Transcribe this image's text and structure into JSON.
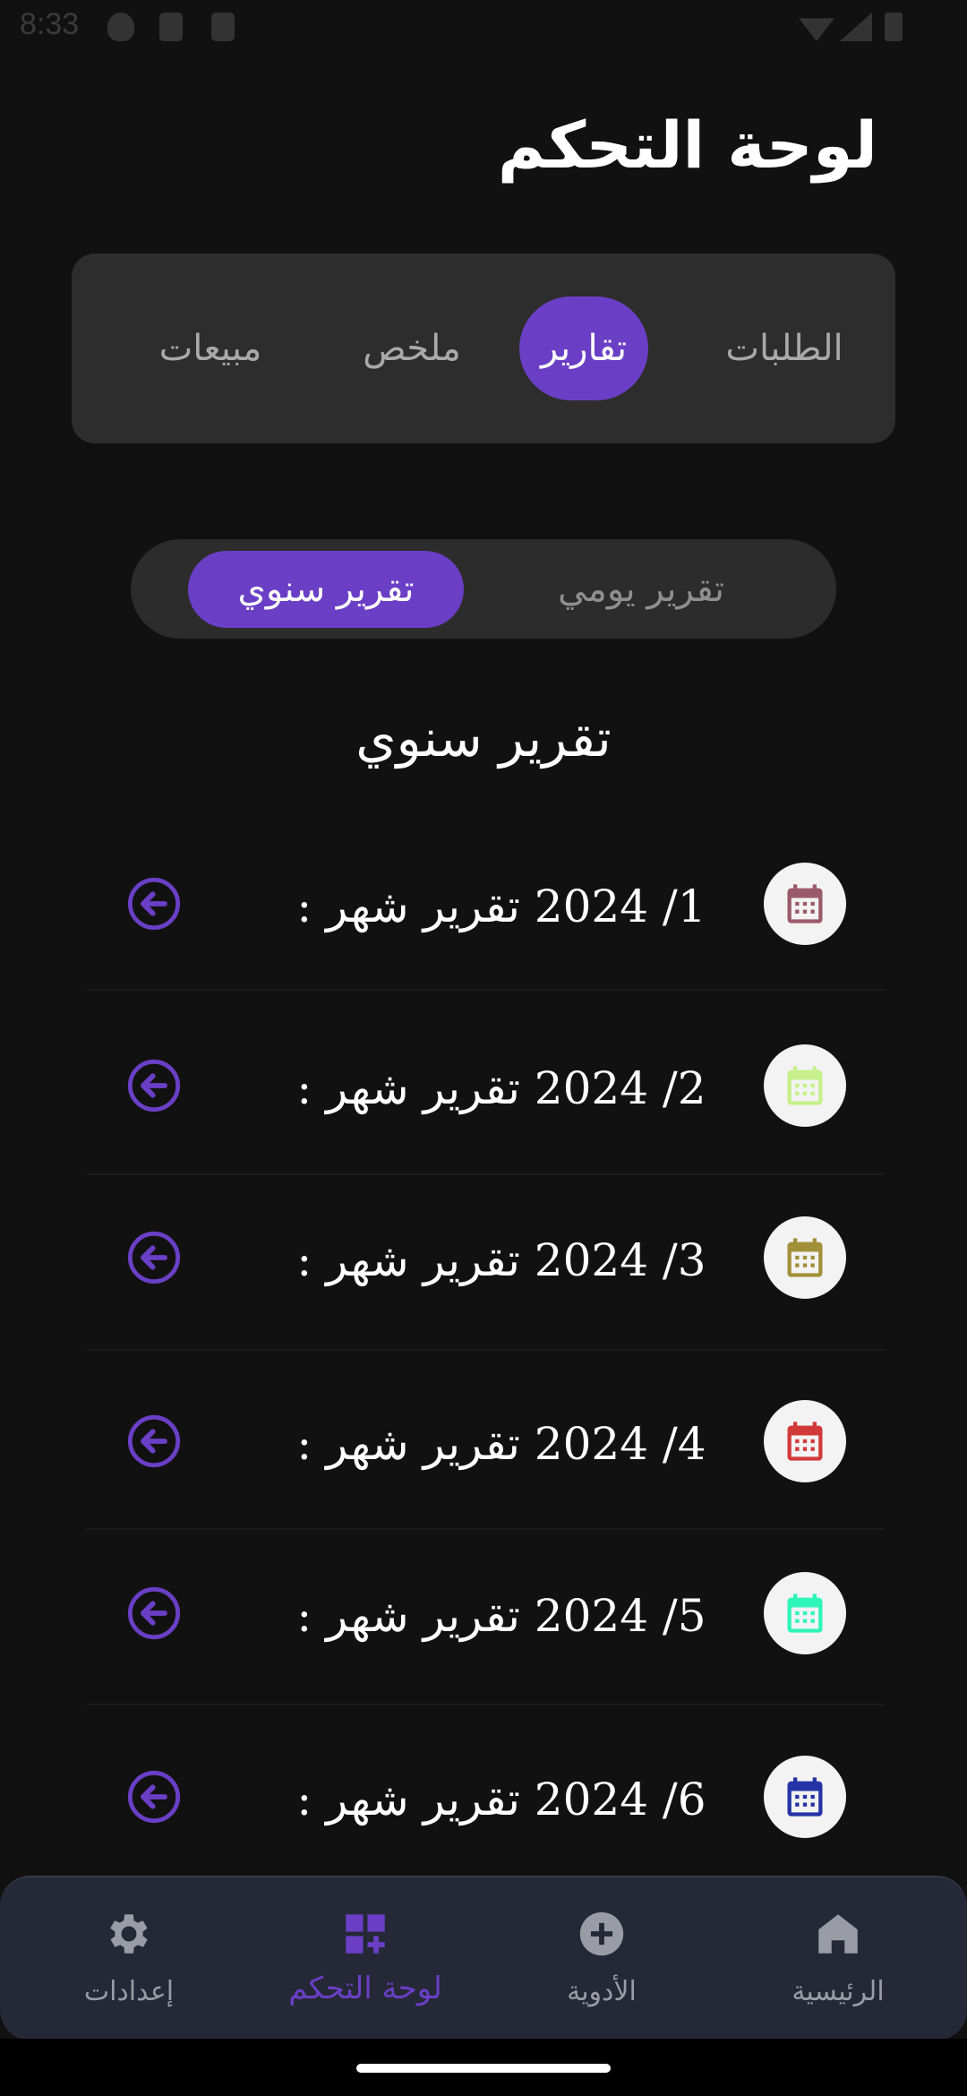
{
  "status_bar": {
    "time": "8:33"
  },
  "title": "لوحة التحكم",
  "main_tabs": [
    {
      "label": "الطلبات",
      "active": false
    },
    {
      "label": "تقارير",
      "active": true
    },
    {
      "label": "ملخص",
      "active": false
    },
    {
      "label": "مبيعات",
      "active": false
    }
  ],
  "segment": {
    "daily": "تقرير يومي",
    "yearly": "تقرير سنوي",
    "selected": "yearly"
  },
  "section_title": "تقرير سنوي",
  "reports": [
    {
      "label": "تقرير شهر  :",
      "value": "2024 /1",
      "icon": "calendar-icon",
      "color": "#9b5a6c"
    },
    {
      "label": "تقرير شهر  :",
      "value": "2024 /2",
      "icon": "calendar-icon",
      "color": "#c5f08a"
    },
    {
      "label": "تقرير شهر  :",
      "value": "2024 /3",
      "icon": "calendar-icon",
      "color": "#a19038"
    },
    {
      "label": "تقرير شهر  :",
      "value": "2024 /4",
      "icon": "calendar-icon",
      "color": "#d23a3a"
    },
    {
      "label": "تقرير شهر  :",
      "value": "2024 /5",
      "icon": "calendar-icon",
      "color": "#2ef5b8"
    },
    {
      "label": "تقرير شهر  :",
      "value": "2024 /6",
      "icon": "calendar-icon",
      "color": "#2433a6"
    }
  ],
  "bottom_nav": [
    {
      "label": "الرئيسية",
      "icon": "home-icon",
      "active": false
    },
    {
      "label": "الأدوية",
      "icon": "add-circle-icon",
      "active": false
    },
    {
      "label": "لوحة التحكم",
      "icon": "dashboard-add-icon",
      "active": true
    },
    {
      "label": "إعدادات",
      "icon": "gear-icon",
      "active": false
    }
  ],
  "colors": {
    "accent": "#6a3fc6",
    "background": "#121111",
    "nav_background": "#252836"
  }
}
